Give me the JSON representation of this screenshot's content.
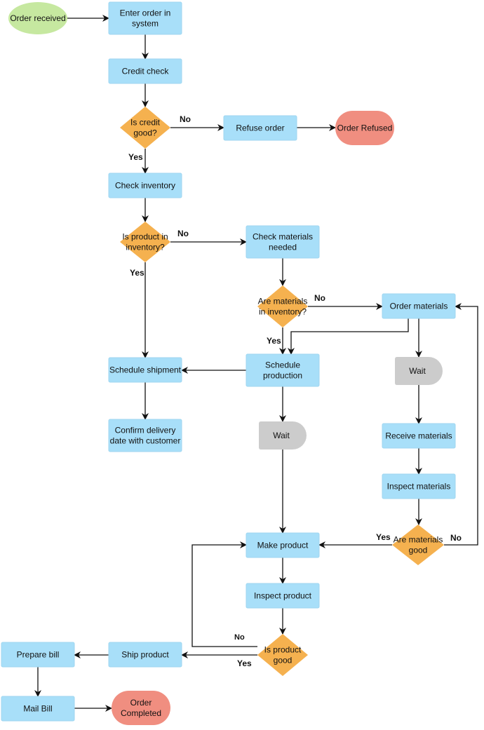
{
  "colors": {
    "process": "#a8dff9",
    "decision": "#f5b14f",
    "start": "#c6e8a0",
    "end": "#f08e80",
    "wait": "#cccccc",
    "line": "#111111"
  },
  "nodes": {
    "order_received": [
      "Order received"
    ],
    "enter_order": [
      "Enter order in",
      "system"
    ],
    "credit_check": [
      "Credit check"
    ],
    "is_credit_good": [
      "Is credit",
      "good?"
    ],
    "refuse_order": [
      "Refuse order"
    ],
    "order_refused": [
      "Order Refused"
    ],
    "check_inventory": [
      "Check inventory"
    ],
    "is_in_inventory": [
      "Is product in",
      "inventory?"
    ],
    "check_materials": [
      "Check materials",
      "needed"
    ],
    "materials_in_inventory": [
      "Are materials",
      "in inventory?"
    ],
    "order_materials": [
      "Order materials"
    ],
    "schedule_shipment": [
      "Schedule shipment"
    ],
    "schedule_production": [
      "Schedule",
      "production"
    ],
    "wait_materials": [
      "Wait"
    ],
    "confirm_delivery": [
      "Confirm delivery",
      "date with customer"
    ],
    "wait_production": [
      "Wait"
    ],
    "receive_materials": [
      "Receive materials"
    ],
    "inspect_materials": [
      "Inspect materials"
    ],
    "materials_good": [
      "Are materials",
      "good"
    ],
    "make_product": [
      "Make product"
    ],
    "inspect_product": [
      "Inspect product"
    ],
    "product_good": [
      "Is product",
      "good"
    ],
    "ship_product": [
      "Ship product"
    ],
    "prepare_bill": [
      "Prepare bill"
    ],
    "mail_bill": [
      "Mail Bill"
    ],
    "order_completed": [
      "Order",
      "Completed"
    ]
  },
  "edge_labels": {
    "yes": "Yes",
    "no": "No"
  }
}
